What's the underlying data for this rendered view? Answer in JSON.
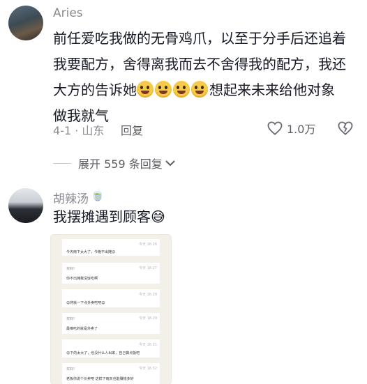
{
  "comment1": {
    "username": "Aries",
    "lines": [
      "前任爱吃我做的无骨鸡爪，以至于分手后还追着",
      "我要配方，舍得离我而去不舍得我的配方，我还",
      "大方的告诉她",
      "想起来未来给他对象",
      "做我就气"
    ],
    "emoji_count": 4,
    "date_location": "4-1 · 山东",
    "reply_label": "回复",
    "like_count": "1.0万"
  },
  "expand_replies": "展开 559 条回复",
  "comment2": {
    "username": "胡辣汤",
    "username_emoji": "🍵",
    "text": "我摆摊遇到顾客",
    "text_emoji": "😅"
  },
  "chat_screenshot": {
    "messages": [
      {
        "time": "今天 16:26",
        "name": "",
        "text": "今天雨下太大了，今晚不出摊😊"
      },
      {
        "time": "今天 16:27",
        "name": "买好!",
        "text": "你不出摊我没饭吃啊"
      },
      {
        "time": "今天 16:28",
        "name": "",
        "text": "😊将就一下点外卖吃吧😊"
      },
      {
        "time": "今天 16:29",
        "name": "买好!",
        "text": "最难吃的就是外卖了"
      },
      {
        "time": "今天 16:31",
        "name": "",
        "text": "😊下的太大了，也没什么人出来，自己做点饭吧"
      },
      {
        "time": "今天 16:32",
        "name": "买好!",
        "text": "老板你说个价卖吧 这样下雨天也能赚钱多好"
      }
    ]
  }
}
